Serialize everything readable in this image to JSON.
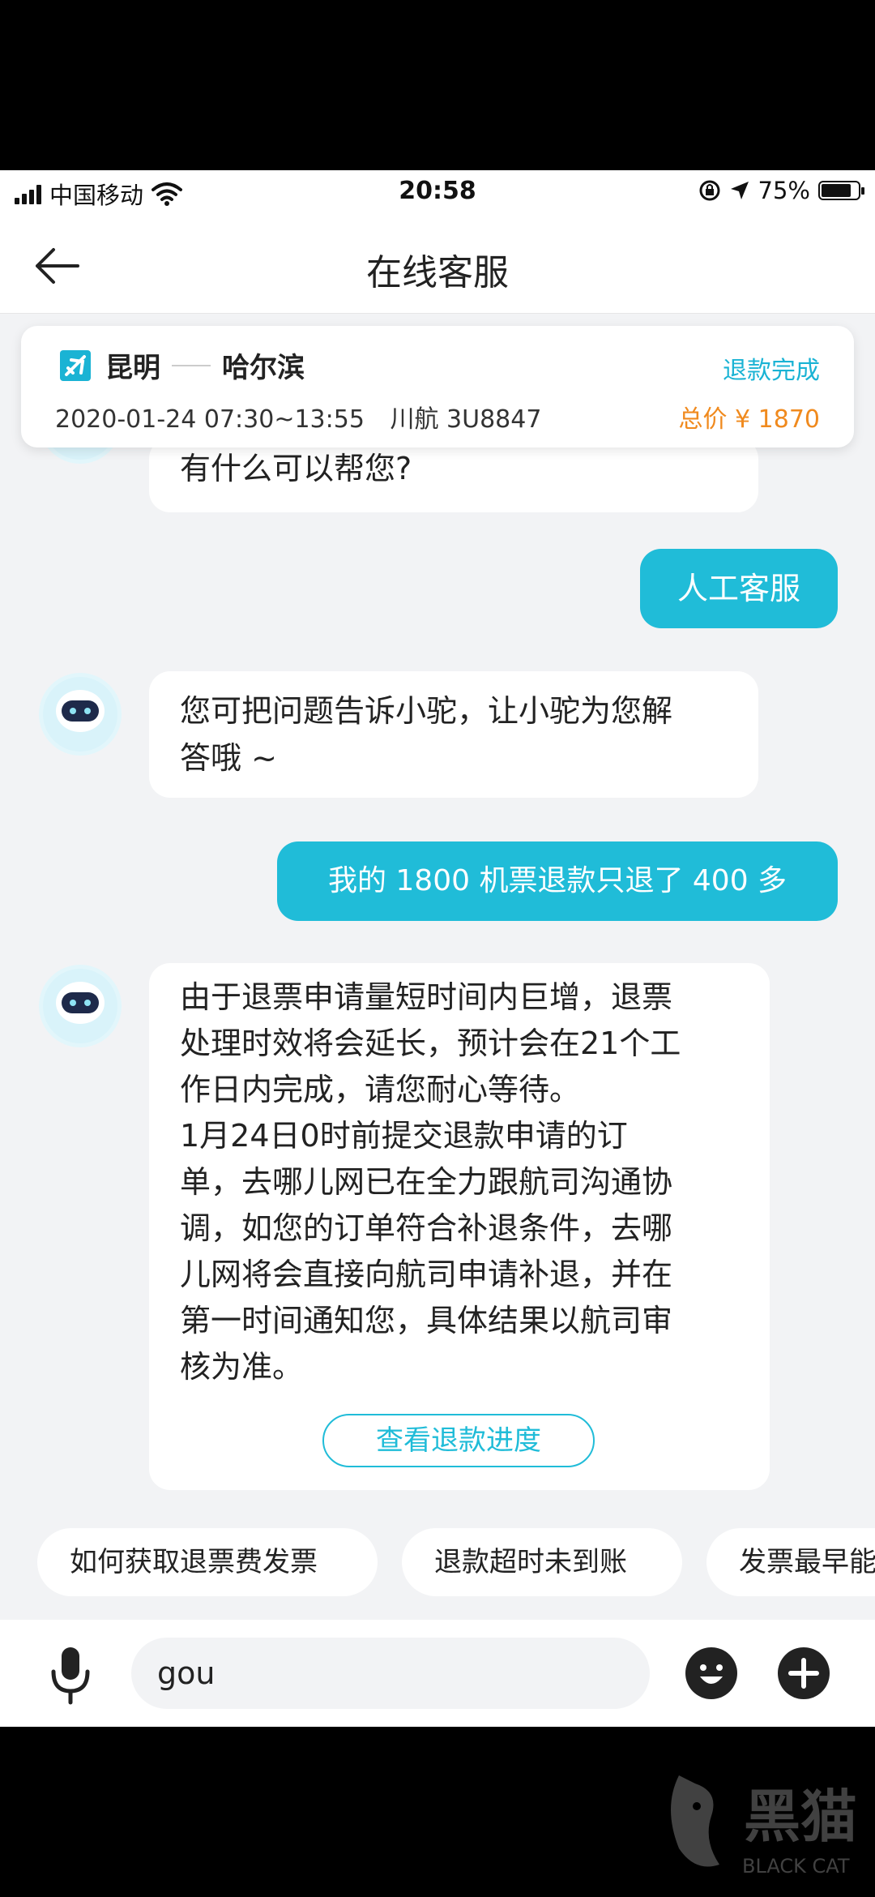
{
  "status_bar": {
    "carrier": "中国移动",
    "time": "20:58",
    "battery": "75%"
  },
  "header": {
    "title": "在线客服",
    "back_icon": "arrow-left-icon"
  },
  "flight": {
    "from": "昆明",
    "to": "哈尔滨",
    "datetime": "2020-01-24 07:30~13:55",
    "flight_no": "川航 3U8847",
    "status": "退款完成",
    "total_price": "总价 ¥ 1870"
  },
  "messages": [
    {
      "side": "bot",
      "text": "有什么可以帮您?"
    },
    {
      "side": "user",
      "text": "人工客服"
    },
    {
      "side": "bot",
      "lines": [
        "您可把问题告诉小驼，让小驼为您解",
        "答哦 ~"
      ]
    },
    {
      "side": "user",
      "text": "我的 1800 机票退款只退了 400 多"
    },
    {
      "side": "bot",
      "lines": [
        "由于退票申请量短时间内巨增，退票",
        "处理时效将会延长，预计会在21个工",
        "作日内完成，请您耐心等待。",
        "1月24日0时前提交退款申请的订",
        "单，去哪儿网已在全力跟航司沟通协",
        "调，如您的订单符合补退条件，去哪",
        "儿网将会直接向航司申请补退，并在",
        "第一时间通知您，具体结果以航司审",
        "核为准。"
      ],
      "button": "查看退款进度"
    }
  ],
  "quick_replies": [
    "如何获取退票费发票",
    "退款超时未到账",
    "发票最早能"
  ],
  "input": {
    "value": "gou"
  },
  "colors": {
    "accent": "#20bcd8",
    "price": "#f08a1e",
    "background": "#f2f3f5"
  },
  "watermark": {
    "text": "黑猫",
    "subtext": "BLACK CAT"
  }
}
